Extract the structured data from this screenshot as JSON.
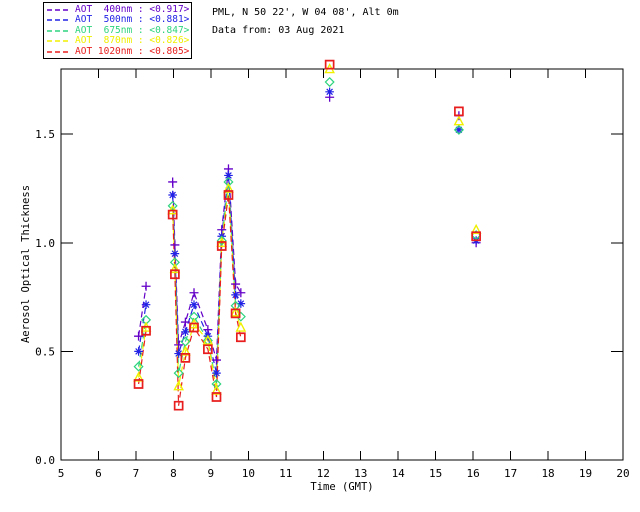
{
  "header": {
    "site_line": "PML, N 50 22', W 04 08', Alt 0m",
    "date_line": "Data from: 03 Aug 2021"
  },
  "chart_data": {
    "type": "line",
    "title": "",
    "xlabel": "Time (GMT)",
    "ylabel": "Aerosol Optical Thickness",
    "xlim": [
      5,
      20
    ],
    "ylim": [
      0,
      1.8
    ],
    "grid": false,
    "legend_position": "top-left",
    "xticks": [
      5,
      6,
      7,
      8,
      9,
      10,
      11,
      12,
      13,
      14,
      15,
      16,
      17,
      18,
      19,
      20
    ],
    "yticks": [
      0.0,
      0.5,
      1.0,
      1.5
    ],
    "ytick_labels": [
      "0.0",
      "0.5",
      "1.0",
      "1.5"
    ],
    "series": [
      {
        "name": "AOT 400nm",
        "wavelength_nm": 400,
        "mean_aot": 0.917,
        "legend_label": "AOT  400nm : <0.917>",
        "color": "#6400C8",
        "marker": "plus"
      },
      {
        "name": "AOT 500nm",
        "wavelength_nm": 500,
        "mean_aot": 0.881,
        "legend_label": "AOT  500nm : <0.881>",
        "color": "#2222E6",
        "marker": "asterisk"
      },
      {
        "name": "AOT 675nm",
        "wavelength_nm": 675,
        "mean_aot": 0.847,
        "legend_label": "AOT  675nm : <0.847>",
        "color": "#2ED47E",
        "marker": "diamond"
      },
      {
        "name": "AOT 870nm",
        "wavelength_nm": 870,
        "mean_aot": 0.826,
        "legend_label": "AOT  870nm : <0.826>",
        "color": "#F0F000",
        "marker": "triangle"
      },
      {
        "name": "AOT 1020nm",
        "wavelength_nm": 1020,
        "mean_aot": 0.805,
        "legend_label": "AOT 1020nm : <0.805>",
        "color": "#E81E1E",
        "marker": "square"
      }
    ],
    "samples": [
      {
        "t": 7.07,
        "pen": "up",
        "values": [
          0.57,
          0.5,
          0.43,
          0.38,
          0.35
        ]
      },
      {
        "t": 7.27,
        "pen": "down",
        "values": [
          0.8,
          0.715,
          0.645,
          0.61,
          0.595
        ]
      },
      {
        "t": 7.98,
        "pen": "up",
        "values": [
          1.28,
          1.22,
          1.17,
          1.15,
          1.13
        ]
      },
      {
        "t": 8.04,
        "pen": "down",
        "values": [
          0.99,
          0.95,
          0.91,
          0.88,
          0.855
        ]
      },
      {
        "t": 8.14,
        "pen": "down",
        "values": [
          0.53,
          0.49,
          0.4,
          0.34,
          0.25
        ]
      },
      {
        "t": 8.32,
        "pen": "down",
        "values": [
          0.635,
          0.59,
          0.545,
          0.5,
          0.47
        ]
      },
      {
        "t": 8.55,
        "pen": "down",
        "values": [
          0.77,
          0.715,
          0.66,
          0.625,
          0.61
        ]
      },
      {
        "t": 8.92,
        "pen": "down",
        "values": [
          0.6,
          0.57,
          0.55,
          0.55,
          0.51
        ]
      },
      {
        "t": 9.15,
        "pen": "down",
        "values": [
          0.46,
          0.4,
          0.35,
          0.32,
          0.29
        ]
      },
      {
        "t": 9.29,
        "pen": "down",
        "values": [
          1.06,
          1.03,
          1.01,
          1.0,
          0.985
        ]
      },
      {
        "t": 9.47,
        "pen": "down",
        "values": [
          1.34,
          1.31,
          1.28,
          1.25,
          1.22
        ]
      },
      {
        "t": 9.66,
        "pen": "down",
        "values": [
          0.81,
          0.76,
          0.71,
          0.68,
          0.675
        ]
      },
      {
        "t": 9.8,
        "pen": "down",
        "values": [
          0.77,
          0.72,
          0.66,
          0.61,
          0.565
        ]
      },
      {
        "t": 12.17,
        "pen": "up",
        "values": [
          1.67,
          1.695,
          1.74,
          1.8,
          1.82
        ]
      },
      {
        "t": 15.62,
        "pen": "up",
        "values": [
          1.585,
          1.52,
          1.52,
          1.56,
          1.605
        ]
      },
      {
        "t": 16.08,
        "pen": "up",
        "values": [
          1.0,
          1.01,
          1.035,
          1.06,
          1.03
        ]
      }
    ]
  }
}
